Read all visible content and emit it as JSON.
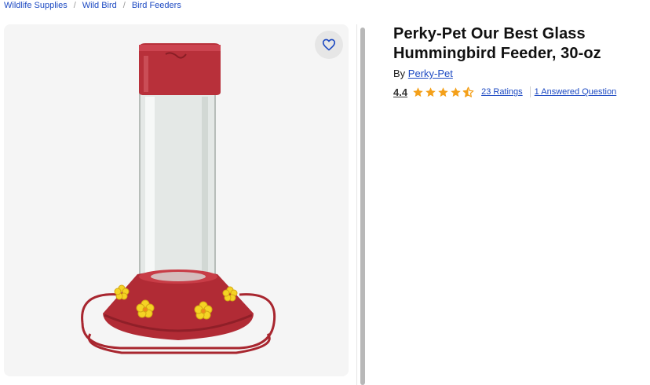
{
  "breadcrumb": {
    "items": [
      "Wildlife Supplies",
      "Wild Bird",
      "Bird Feeders"
    ],
    "separator": "/"
  },
  "product": {
    "title_line1": "Perky-Pet Our Best Glass",
    "title_line2": "Hummingbird Feeder, 30-oz",
    "by_prefix": "By",
    "brand": "Perky-Pet",
    "rating": "4.4",
    "rating_value": 4.4,
    "ratings_count_label": "23 Ratings",
    "questions_label": "1 Answered Question"
  },
  "icons": {
    "favorite": "heart-icon",
    "star": "star-icon"
  },
  "colors": {
    "link": "#1c49c2",
    "star": "#f4a01a",
    "feeder_red": "#b8303a",
    "flower_yellow": "#f5d324"
  }
}
